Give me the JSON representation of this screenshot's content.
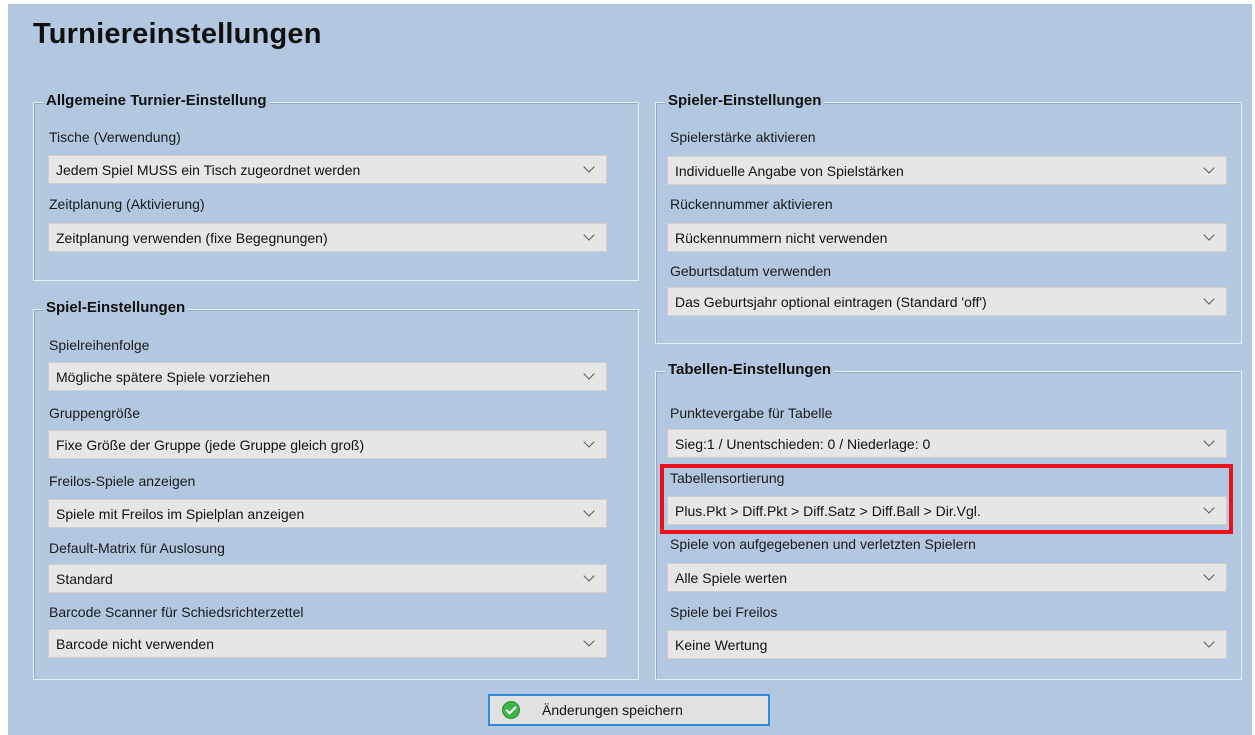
{
  "page_title": "Turniereinstellungen",
  "general": {
    "title": "Allgemeine Turnier-Einstellung",
    "fields": [
      {
        "label": "Tische (Verwendung)",
        "value": "Jedem Spiel MUSS ein Tisch zugeordnet werden"
      },
      {
        "label": "Zeitplanung (Aktivierung)",
        "value": "Zeitplanung verwenden (fixe Begegnungen)"
      }
    ]
  },
  "game": {
    "title": "Spiel-Einstellungen",
    "fields": [
      {
        "label": "Spielreihenfolge",
        "value": "Mögliche spätere Spiele vorziehen"
      },
      {
        "label": "Gruppengröße",
        "value": "Fixe Größe der Gruppe (jede Gruppe gleich groß)"
      },
      {
        "label": "Freilos-Spiele anzeigen",
        "value": "Spiele mit Freilos im Spielplan anzeigen"
      },
      {
        "label": "Default-Matrix für Auslosung",
        "value": "Standard"
      },
      {
        "label": "Barcode Scanner für Schiedsrichterzettel",
        "value": "Barcode nicht verwenden"
      }
    ]
  },
  "player": {
    "title": "Spieler-Einstellungen",
    "fields": [
      {
        "label": "Spielerstärke aktivieren",
        "value": "Individuelle Angabe von Spielstärken"
      },
      {
        "label": "Rückennummer aktivieren",
        "value": "Rückennummern nicht verwenden"
      },
      {
        "label": "Geburtsdatum verwenden",
        "value": "Das Geburtsjahr optional eintragen (Standard 'off')"
      }
    ]
  },
  "table": {
    "title": "Tabellen-Einstellungen",
    "fields": [
      {
        "label": "Punktevergabe für Tabelle",
        "value": "Sieg:1 / Unentschieden: 0 / Niederlage: 0"
      },
      {
        "label": "Tabellensortierung",
        "value": "Plus.Pkt > Diff.Pkt > Diff.Satz > Diff.Ball > Dir.Vgl."
      },
      {
        "label": "Spiele von aufgegebenen und verletzten Spielern",
        "value": "Alle Spiele werten"
      },
      {
        "label": "Spiele bei Freilos",
        "value": "Keine Wertung"
      }
    ]
  },
  "save_button": {
    "label": "Änderungen speichern",
    "icon": "check-circle-icon"
  },
  "colors": {
    "panel_bg": "#b3c8e0",
    "highlight": "#e8121a",
    "button_border": "#2f8bd6",
    "check": "#3cb54a"
  }
}
